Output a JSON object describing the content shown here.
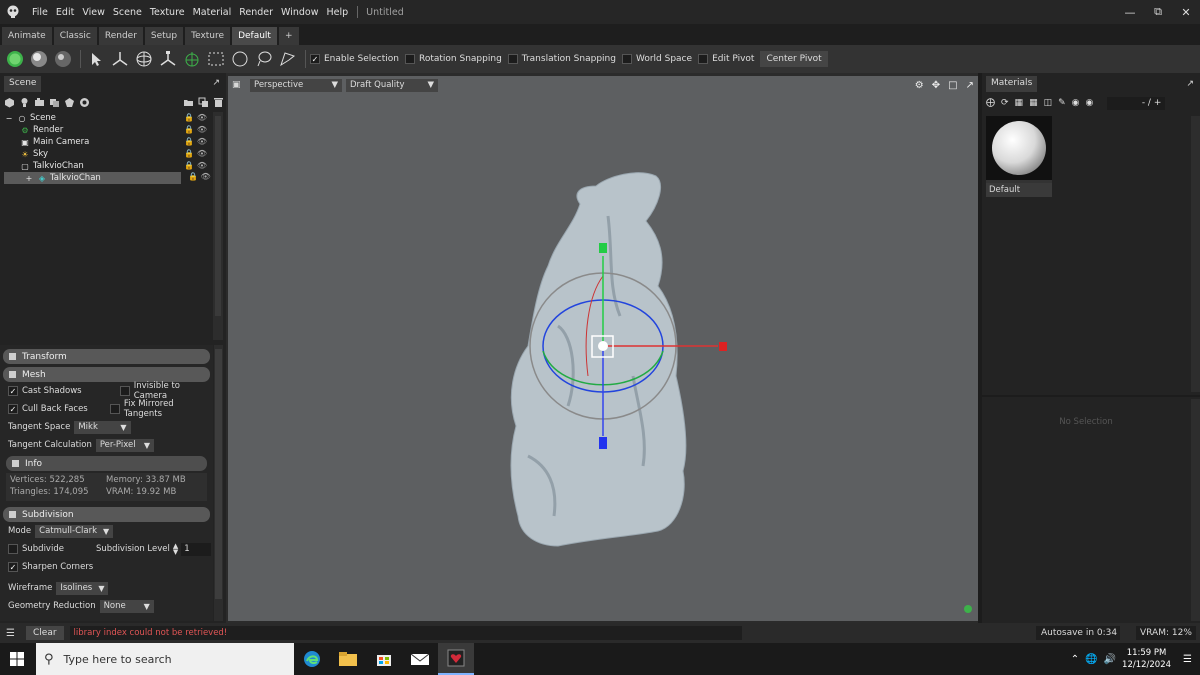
{
  "app": {
    "title": "Untitled"
  },
  "menu": [
    "File",
    "Edit",
    "View",
    "Scene",
    "Texture",
    "Material",
    "Render",
    "Window",
    "Help"
  ],
  "tabs": [
    "Animate",
    "Classic",
    "Render",
    "Setup",
    "Texture",
    "Default",
    "+"
  ],
  "toolbar": {
    "enable_selection": "Enable Selection",
    "rotation_snapping": "Rotation Snapping",
    "translation_snapping": "Translation Snapping",
    "world_space": "World Space",
    "edit_pivot": "Edit Pivot",
    "center_pivot": "Center Pivot"
  },
  "scene_panel": {
    "title": "Scene",
    "tree": [
      {
        "label": "Scene",
        "icon": "scene-icon"
      },
      {
        "label": "Render",
        "icon": "render-icon"
      },
      {
        "label": "Main Camera",
        "icon": "camera-icon"
      },
      {
        "label": "Sky",
        "icon": "sky-icon"
      },
      {
        "label": "TalkvioChan",
        "icon": "object-icon"
      },
      {
        "label": "TalkvioChan",
        "icon": "mesh-icon",
        "selected": true
      }
    ]
  },
  "properties": {
    "transform": "Transform",
    "mesh": "Mesh",
    "cast_shadows": "Cast Shadows",
    "invisible_to_camera": "Invisible to Camera",
    "cull_back_faces": "Cull Back Faces",
    "fix_mirrored_tangents": "Fix Mirrored Tangents",
    "tangent_space_label": "Tangent Space",
    "tangent_space_value": "Mikk",
    "tangent_calc_label": "Tangent Calculation",
    "tangent_calc_value": "Per-Pixel",
    "info": "Info",
    "vertices": "Vertices: 522,285",
    "triangles": "Triangles: 174,095",
    "memory": "Memory: 33.87 MB",
    "vram": "VRAM: 19.92 MB",
    "subdivision": "Subdivision",
    "mode_label": "Mode",
    "mode_value": "Catmull-Clark",
    "subdivide": "Subdivide",
    "subdiv_level_label": "Subdivision Level",
    "subdiv_level_value": "1",
    "sharpen_corners": "Sharpen Corners",
    "wireframe_label": "Wireframe",
    "wireframe_value": "Isolines",
    "geo_reduction_label": "Geometry Reduction",
    "geo_reduction_value": "None"
  },
  "viewport": {
    "camera": "Perspective",
    "quality": "Draft Quality"
  },
  "materials": {
    "title": "Materials",
    "counter": "- / +",
    "items": [
      {
        "label": "Default"
      }
    ],
    "no_selection": "No Selection"
  },
  "status": {
    "clear": "Clear",
    "message": "library index could not be retrieved!",
    "autosave": "Autosave in 0:34",
    "vram": "VRAM: 12%"
  },
  "taskbar": {
    "search_placeholder": "Type here to search",
    "time": "11:59 PM",
    "date": "12/12/2024"
  },
  "colors": {
    "accent_green": "#3db24a",
    "error_text": "#e05555"
  }
}
